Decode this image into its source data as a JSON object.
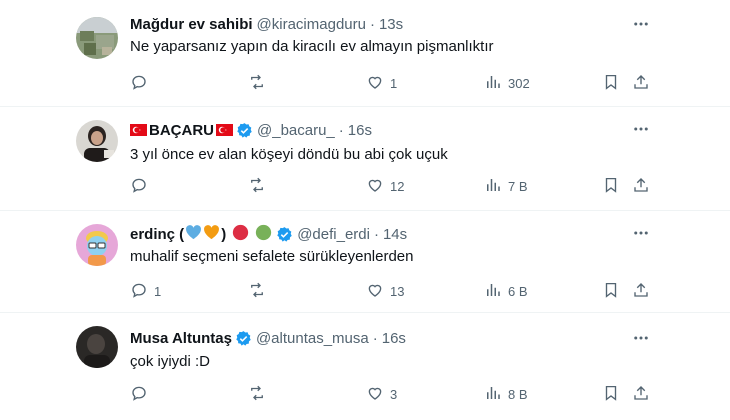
{
  "tweets": [
    {
      "name": "Mağdur ev sahibi",
      "handle": "@kiracimagduru",
      "separator": "·",
      "time": "13s",
      "text": "Ne yaparsanız yapın da kiracılı ev almayın pişmanlıktır",
      "replies": "",
      "retweets": "",
      "likes": "1",
      "views": "302",
      "verified": false
    },
    {
      "name": "BAÇARU",
      "handle": "@_bacaru_",
      "separator": "·",
      "time": "16s",
      "text": "3 yıl önce ev alan köşeyi döndü bu abi çok uçuk",
      "replies": "",
      "retweets": "",
      "likes": "12",
      "views": "7 B",
      "verified": true
    },
    {
      "name": "erdinç (",
      "name_close": ")",
      "handle": "@defi_erdi",
      "separator": "·",
      "time": "14s",
      "text": "muhalif seçmeni sefalete sürükleyenlerden",
      "replies": "1",
      "retweets": "",
      "likes": "13",
      "views": "6 B",
      "verified": true
    },
    {
      "name": "Musa Altuntaş",
      "handle": "@altuntas_musa",
      "separator": "·",
      "time": "16s",
      "text": "çok iyiydi :D",
      "replies": "",
      "retweets": "",
      "likes": "3",
      "views": "8 B",
      "verified": true
    }
  ],
  "icons": {
    "reply": "reply-icon",
    "retweet": "retweet-icon",
    "like": "heart-icon",
    "views": "views-icon",
    "bookmark": "bookmark-icon",
    "share": "share-icon",
    "more": "more-icon",
    "verified": "verified-badge-icon"
  },
  "colors": {
    "text_primary": "#0f1419",
    "text_secondary": "#536471",
    "verified": "#1d9bf0",
    "divider": "#eff3f4",
    "flag_red": "#e30a17"
  }
}
